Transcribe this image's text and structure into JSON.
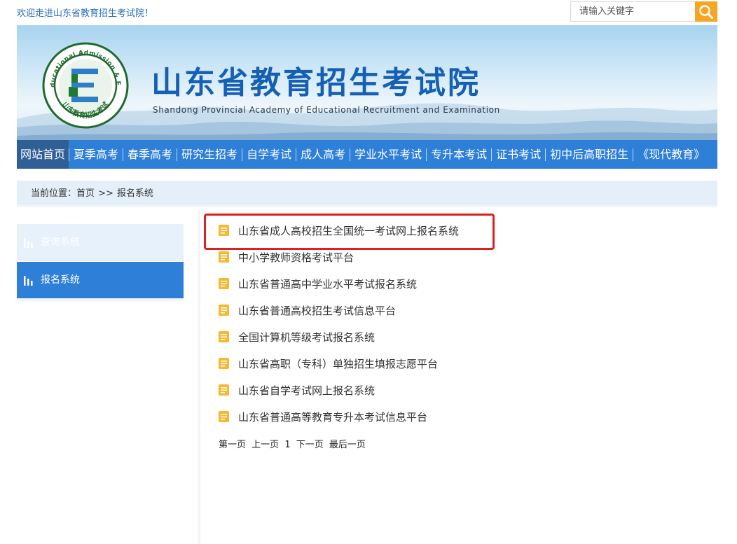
{
  "topbar": {
    "welcome": "欢迎走进山东省教育招生考试院！",
    "search_placeholder": "请输入关键字"
  },
  "banner": {
    "logo_ring_text": "Shandong Educational Admission & Examinations",
    "logo_bottom_text": "山东教育招生考试",
    "logo_letter": "E",
    "title": "山东省教育招生考试院",
    "subtitle": "Shandong Provincial Academy of Educational Recruitment and Examination"
  },
  "nav": {
    "items": [
      {
        "label": "网站首页",
        "active": true
      },
      {
        "label": "夏季高考"
      },
      {
        "label": "春季高考"
      },
      {
        "label": "研究生招考"
      },
      {
        "label": "自学考试"
      },
      {
        "label": "成人高考"
      },
      {
        "label": "学业水平考试"
      },
      {
        "label": "专升本考试"
      },
      {
        "label": "证书考试"
      },
      {
        "label": "初中后高职招生"
      },
      {
        "label": "《现代教育》"
      }
    ]
  },
  "breadcrumb": {
    "label": "当前位置：",
    "home": "首页",
    "sep": ">>",
    "current": "报名系统"
  },
  "sidebar": {
    "items": [
      {
        "label": "查询系统",
        "active": false
      },
      {
        "label": "报名系统",
        "active": true
      }
    ]
  },
  "list": {
    "items": [
      "山东省成人高校招生全国统一考试网上报名系统",
      "中小学教师资格考试平台",
      "山东省普通高中学业水平考试报名系统",
      "山东省普通高校招生考试信息平台",
      "全国计算机等级考试报名系统",
      "山东省高职（专科）单独招生填报志愿平台",
      "山东省自学考试网上报名系统",
      "山东省普通高等教育专升本考试信息平台"
    ],
    "highlight_index": 0
  },
  "pager": {
    "first": "第一页",
    "prev": "上一页",
    "current": "1",
    "next": "下一页",
    "last": "最后一页"
  },
  "colors": {
    "nav_bg": "#2d7fd8",
    "nav_active": "#2f5f95",
    "search_btn": "#f5a623",
    "highlight": "#e02020",
    "doc_icon": "#f5b82e"
  }
}
